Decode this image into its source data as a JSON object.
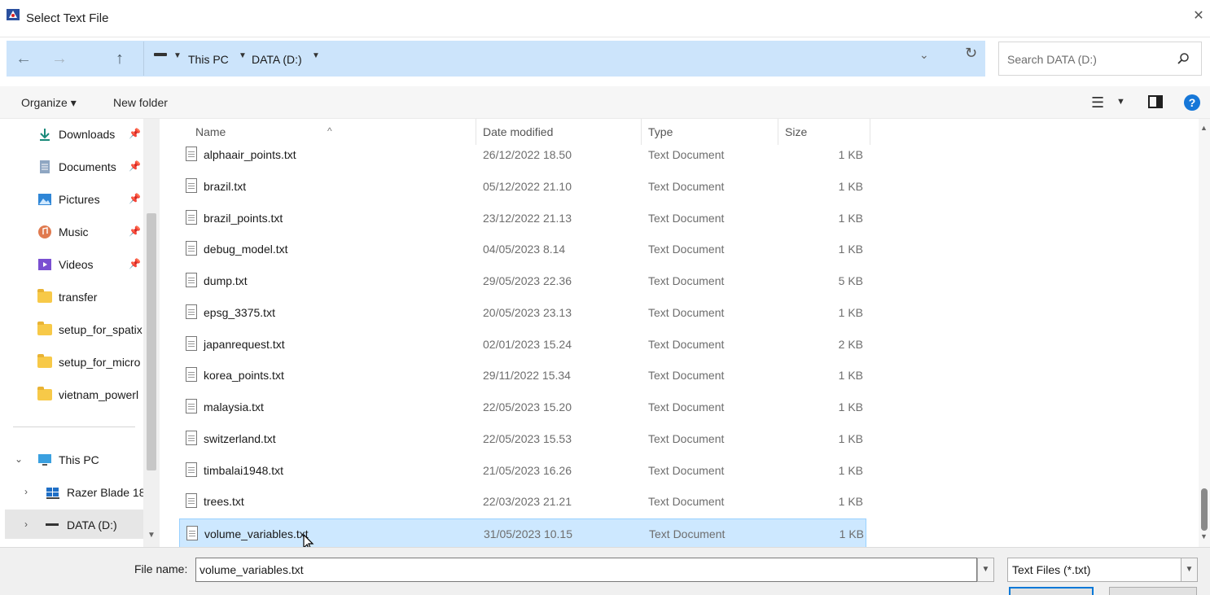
{
  "window": {
    "title": "Select Text File",
    "close_glyph": "✕"
  },
  "address": {
    "back_glyph": "←",
    "forward_glyph": "→",
    "up_glyph": "↑",
    "breadcrumbs": [
      "This PC",
      "DATA (D:)"
    ],
    "history_glyph": "⌄",
    "refresh_glyph": "↻"
  },
  "search": {
    "placeholder": "Search DATA (D:)"
  },
  "toolbar": {
    "organize_label": "Organize ▾",
    "new_folder_label": "New folder",
    "help_label": "?"
  },
  "sidebar": {
    "quick_access": [
      {
        "label": "Downloads",
        "icon": "download-arrow-icon"
      },
      {
        "label": "Documents",
        "icon": "document-icon"
      },
      {
        "label": "Pictures",
        "icon": "picture-icon"
      },
      {
        "label": "Music",
        "icon": "music-icon"
      },
      {
        "label": "Videos",
        "icon": "video-icon"
      },
      {
        "label": "transfer",
        "icon": "folder-icon"
      },
      {
        "label": "setup_for_spatix",
        "icon": "folder-icon"
      },
      {
        "label": "setup_for_micro",
        "icon": "folder-icon"
      },
      {
        "label": "vietnam_powerl",
        "icon": "folder-icon"
      }
    ],
    "this_pc": {
      "label": "This PC"
    },
    "drives": [
      {
        "label": "Razer Blade 18"
      },
      {
        "label": "DATA (D:)"
      }
    ]
  },
  "columns": {
    "name": "Name",
    "date": "Date modified",
    "type": "Type",
    "size": "Size"
  },
  "files": [
    {
      "name": "alphaair_points.txt",
      "date": "26/12/2022 18.50",
      "type": "Text Document",
      "size": "1 KB"
    },
    {
      "name": "brazil.txt",
      "date": "05/12/2022 21.10",
      "type": "Text Document",
      "size": "1 KB"
    },
    {
      "name": "brazil_points.txt",
      "date": "23/12/2022 21.13",
      "type": "Text Document",
      "size": "1 KB"
    },
    {
      "name": "debug_model.txt",
      "date": "04/05/2023 8.14",
      "type": "Text Document",
      "size": "1 KB"
    },
    {
      "name": "dump.txt",
      "date": "29/05/2023 22.36",
      "type": "Text Document",
      "size": "5 KB"
    },
    {
      "name": "epsg_3375.txt",
      "date": "20/05/2023 23.13",
      "type": "Text Document",
      "size": "1 KB"
    },
    {
      "name": "japanrequest.txt",
      "date": "02/01/2023 15.24",
      "type": "Text Document",
      "size": "2 KB"
    },
    {
      "name": "korea_points.txt",
      "date": "29/11/2022 15.34",
      "type": "Text Document",
      "size": "1 KB"
    },
    {
      "name": "malaysia.txt",
      "date": "22/05/2023 15.20",
      "type": "Text Document",
      "size": "1 KB"
    },
    {
      "name": "switzerland.txt",
      "date": "22/05/2023 15.53",
      "type": "Text Document",
      "size": "1 KB"
    },
    {
      "name": "timbalai1948.txt",
      "date": "21/05/2023 16.26",
      "type": "Text Document",
      "size": "1 KB"
    },
    {
      "name": "trees.txt",
      "date": "22/03/2023 21.21",
      "type": "Text Document",
      "size": "1 KB"
    },
    {
      "name": "volume_variables.txt",
      "date": "31/05/2023 10.15",
      "type": "Text Document",
      "size": "1 KB"
    }
  ],
  "selected_file": "volume_variables.txt",
  "bottom": {
    "file_name_label": "File name:",
    "file_name_value": "volume_variables.txt",
    "file_type_value": "Text Files (*.txt)"
  },
  "colors": {
    "address_bg": "#cce4fb",
    "selection_bg": "#cde8ff",
    "accent": "#0078d7"
  }
}
